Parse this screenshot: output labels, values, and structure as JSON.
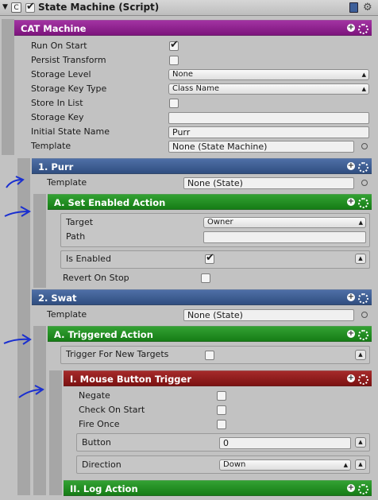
{
  "component": {
    "title": "State Machine (Script)"
  },
  "colors": {
    "purple": "#8f1e8f",
    "blue": "#3f5f92",
    "green": "#1f8c1f",
    "red": "#8f1a1a"
  },
  "cat": {
    "header": "CAT Machine",
    "run_on_start": "Run On Start",
    "run_on_start_value": true,
    "persist_transform": "Persist Transform",
    "persist_transform_value": false,
    "storage_level": "Storage Level",
    "storage_level_value": "None",
    "storage_key_type": "Storage Key Type",
    "storage_key_type_value": "Class Name",
    "store_in_list": "Store In List",
    "store_in_list_value": false,
    "storage_key": "Storage Key",
    "storage_key_value": "",
    "initial_state_name": "Initial State Name",
    "initial_state_name_value": "Purr",
    "template": "Template",
    "template_value": "None (State Machine)"
  },
  "purr": {
    "header": "1. Purr",
    "template": "Template",
    "template_value": "None (State)",
    "set_enabled": {
      "header": "A. Set Enabled Action",
      "target": "Target",
      "target_value": "Owner",
      "path": "Path",
      "path_value": "",
      "is_enabled": "Is Enabled",
      "is_enabled_value": true,
      "revert": "Revert On Stop",
      "revert_value": false
    }
  },
  "swat": {
    "header": "2. Swat",
    "template": "Template",
    "template_value": "None (State)",
    "triggered": {
      "header": "A. Triggered Action",
      "trigger_new": "Trigger For New Targets",
      "trigger_new_value": false
    },
    "mouse": {
      "header": "I. Mouse Button Trigger",
      "negate": "Negate",
      "check_on_start": "Check On Start",
      "fire_once": "Fire Once",
      "button": "Button",
      "button_value": "0",
      "direction": "Direction",
      "direction_value": "Down"
    },
    "log": {
      "header": "II. Log Action"
    }
  }
}
